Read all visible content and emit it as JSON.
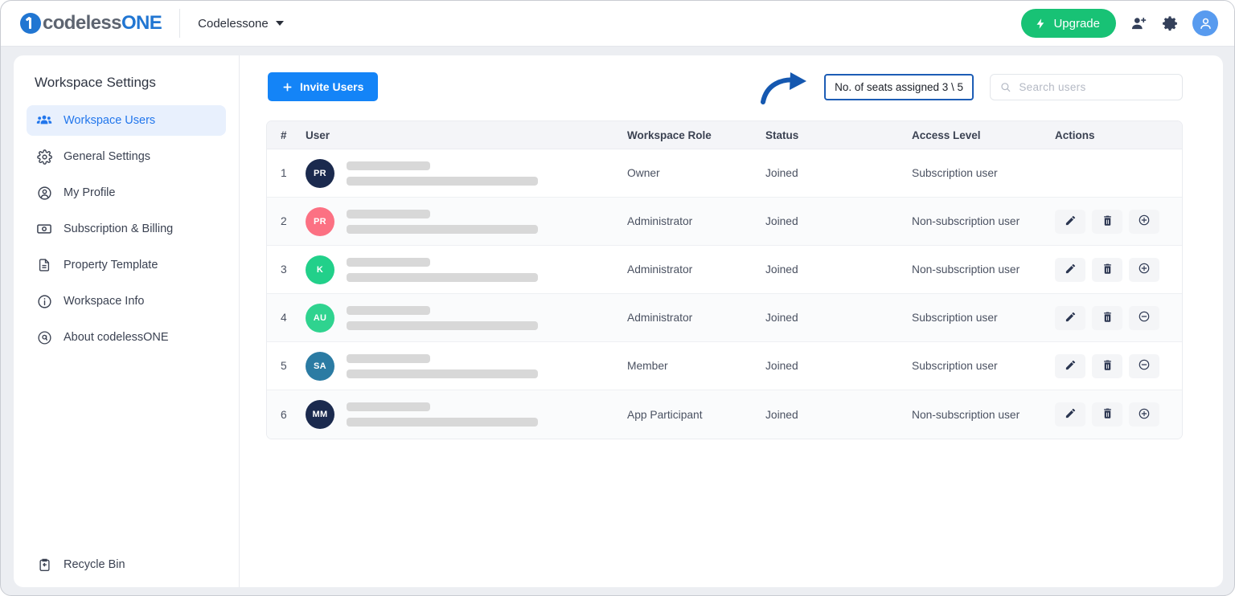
{
  "topbar": {
    "brand_primary": "codeless",
    "brand_accent": "ONE",
    "workspace_name": "Codelessone",
    "upgrade_label": "Upgrade",
    "upgrade_color": "#18c275",
    "icons": [
      "add-user-icon",
      "gear-icon",
      "profile-avatar-icon"
    ]
  },
  "sidebar": {
    "title": "Workspace Settings",
    "items": [
      {
        "label": "Workspace Users",
        "icon": "people-icon",
        "active": true
      },
      {
        "label": "General Settings",
        "icon": "gear-icon",
        "active": false
      },
      {
        "label": "My Profile",
        "icon": "user-circle-icon",
        "active": false
      },
      {
        "label": "Subscription & Billing",
        "icon": "banknote-icon",
        "active": false
      },
      {
        "label": "Property Template",
        "icon": "document-icon",
        "active": false
      },
      {
        "label": "Workspace Info",
        "icon": "info-circle-icon",
        "active": false
      },
      {
        "label": "About codelessONE",
        "icon": "at-circle-icon",
        "active": false
      }
    ],
    "footer": {
      "label": "Recycle Bin",
      "icon": "recycle-bin-icon"
    },
    "active_color": "#2176ec"
  },
  "toolbar": {
    "invite_label": "Invite Users",
    "invite_color": "#1484f7",
    "seats_badge": "No. of seats assigned 3 \\ 5",
    "seats_badge_border": "#1d5db5",
    "search_placeholder": "Search users",
    "search_value": "",
    "annotation": {
      "type": "curved-arrow",
      "color": "#1558b0",
      "points_to": "seats-badge"
    }
  },
  "table": {
    "columns": [
      "#",
      "User",
      "Workspace Role",
      "Status",
      "Access Level",
      "Actions"
    ],
    "rows": [
      {
        "num": "1",
        "initials": "PR",
        "avatar_color": "#1b2a4e",
        "role": "Owner",
        "status": "Joined",
        "access": "Subscription user",
        "actions": []
      },
      {
        "num": "2",
        "initials": "PR",
        "avatar_color": "#fc7183",
        "role": "Administrator",
        "status": "Joined",
        "access": "Non-subscription user",
        "actions": [
          "edit-icon",
          "delete-icon",
          "plus-circle-icon"
        ]
      },
      {
        "num": "3",
        "initials": "K",
        "avatar_color": "#22d08a",
        "role": "Administrator",
        "status": "Joined",
        "access": "Non-subscription user",
        "actions": [
          "edit-icon",
          "delete-icon",
          "plus-circle-icon"
        ]
      },
      {
        "num": "4",
        "initials": "AU",
        "avatar_color": "#2fd38f",
        "role": "Administrator",
        "status": "Joined",
        "access": "Subscription user",
        "actions": [
          "edit-icon",
          "delete-icon",
          "minus-circle-icon"
        ]
      },
      {
        "num": "5",
        "initials": "SA",
        "avatar_color": "#2b7ba3",
        "role": "Member",
        "status": "Joined",
        "access": "Subscription user",
        "actions": [
          "edit-icon",
          "delete-icon",
          "minus-circle-icon"
        ]
      },
      {
        "num": "6",
        "initials": "MM",
        "avatar_color": "#1b2a4e",
        "role": "App Participant",
        "status": "Joined",
        "access": "Non-subscription user",
        "actions": [
          "edit-icon",
          "delete-icon",
          "plus-circle-icon"
        ]
      }
    ]
  }
}
